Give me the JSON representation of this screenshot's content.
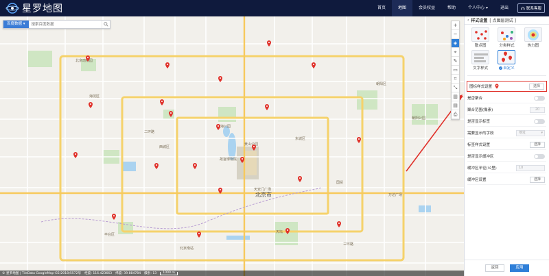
{
  "app": {
    "title": "星罗地图"
  },
  "nav": {
    "items": [
      {
        "label": "首页",
        "active": false
      },
      {
        "label": "地图",
        "active": true
      },
      {
        "label": "会员权益",
        "active": false
      },
      {
        "label": "帮助",
        "active": false
      },
      {
        "label": "个人中心 ▾",
        "active": false
      },
      {
        "label": "退出",
        "active": false
      }
    ],
    "contact_label": "联系客服"
  },
  "search": {
    "source_label": "百度数据 ▾",
    "placeholder": "搜索百度数据"
  },
  "map": {
    "labels": {
      "city": "北京市",
      "beijing_zoo": "北京动物园",
      "palace_museum": "故宫博物院",
      "tiananmen": "天安门广场",
      "tiantan": "天坛",
      "jingshan": "景山公园",
      "chaoyang_park": "朝阳公园",
      "guomao": "国贸",
      "wanda": "万达广场",
      "beihai": "北海公园",
      "xicheng": "西城区",
      "dongcheng": "东城区",
      "haidian": "海淀区",
      "fengtai": "丰台区",
      "chaoyang": "朝阳区",
      "south_station": "北京南站",
      "capital_ring": "三环路",
      "ring2": "二环路"
    },
    "tools": [
      "zoom-in",
      "zoom-out",
      "layers",
      "location",
      "draw",
      "ruler",
      "crop",
      "measure",
      "chart",
      "table",
      "print"
    ],
    "pins": 20
  },
  "status": {
    "attribution": "© 星罗地图 | TileData GoogleMap-GS(2018)5572号",
    "longitude": "经度: 116.423663",
    "latitude": "纬度: 39.884784",
    "zoom": "级别: 13",
    "scale": "1000 m"
  },
  "panel": {
    "back_icon": "chevron-left-icon",
    "title": "样式设置",
    "subtitle": "[ 点图层测试 ]",
    "styles": [
      {
        "label": "散点图",
        "selected": false
      },
      {
        "label": "分类样式",
        "selected": false
      },
      {
        "label": "热力图",
        "selected": false
      },
      {
        "label": "文字样式",
        "selected": false
      },
      {
        "label": "自定义",
        "selected": true
      }
    ],
    "icon_style_label": "图标样式设置",
    "choose_label": "选择",
    "props": [
      {
        "label": "是否聚合",
        "kind": "toggle"
      },
      {
        "label": "聚合范围(像素)",
        "kind": "field-narrow",
        "value": "20"
      },
      {
        "label": "是否显示标签",
        "kind": "toggle"
      },
      {
        "label": "需要显示的字段",
        "kind": "select",
        "value": "地址"
      },
      {
        "label": "标签样式设置",
        "kind": "button"
      },
      {
        "label": "是否显示缓冲区",
        "kind": "toggle"
      },
      {
        "label": "缓冲区半径(公里)",
        "kind": "field",
        "value": "10"
      },
      {
        "label": "缓冲区设置",
        "kind": "button"
      }
    ],
    "reset_label": "返回",
    "apply_label": "应用"
  },
  "colors": {
    "topbar": "#0f1a3d",
    "accent": "#2f7fd8",
    "pin": "#e0322b",
    "highlight": "#e0322b"
  }
}
